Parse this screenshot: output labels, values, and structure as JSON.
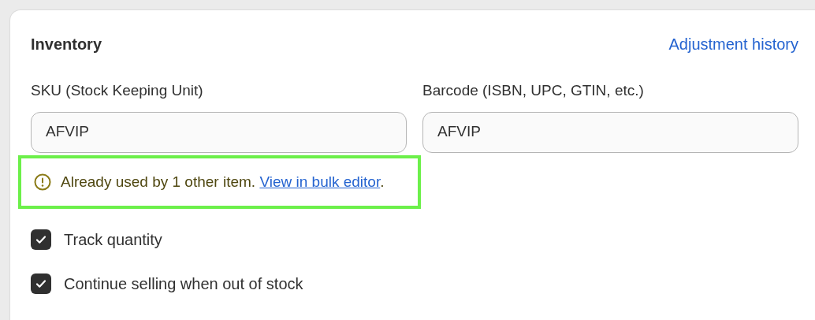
{
  "card": {
    "title": "Inventory",
    "header_link": "Adjustment history"
  },
  "fields": [
    {
      "label": "SKU (Stock Keeping Unit)",
      "value": "AFVIP"
    },
    {
      "label": "Barcode (ISBN, UPC, GTIN, etc.)",
      "value": "AFVIP"
    }
  ],
  "warning": {
    "message": "Already used by 1 other item.",
    "link": "View in bulk editor",
    "trailing": ".",
    "highlighted": true
  },
  "checkboxes": [
    {
      "label": "Track quantity",
      "checked": true
    },
    {
      "label": "Continue selling when out of stock",
      "checked": true
    }
  ]
}
